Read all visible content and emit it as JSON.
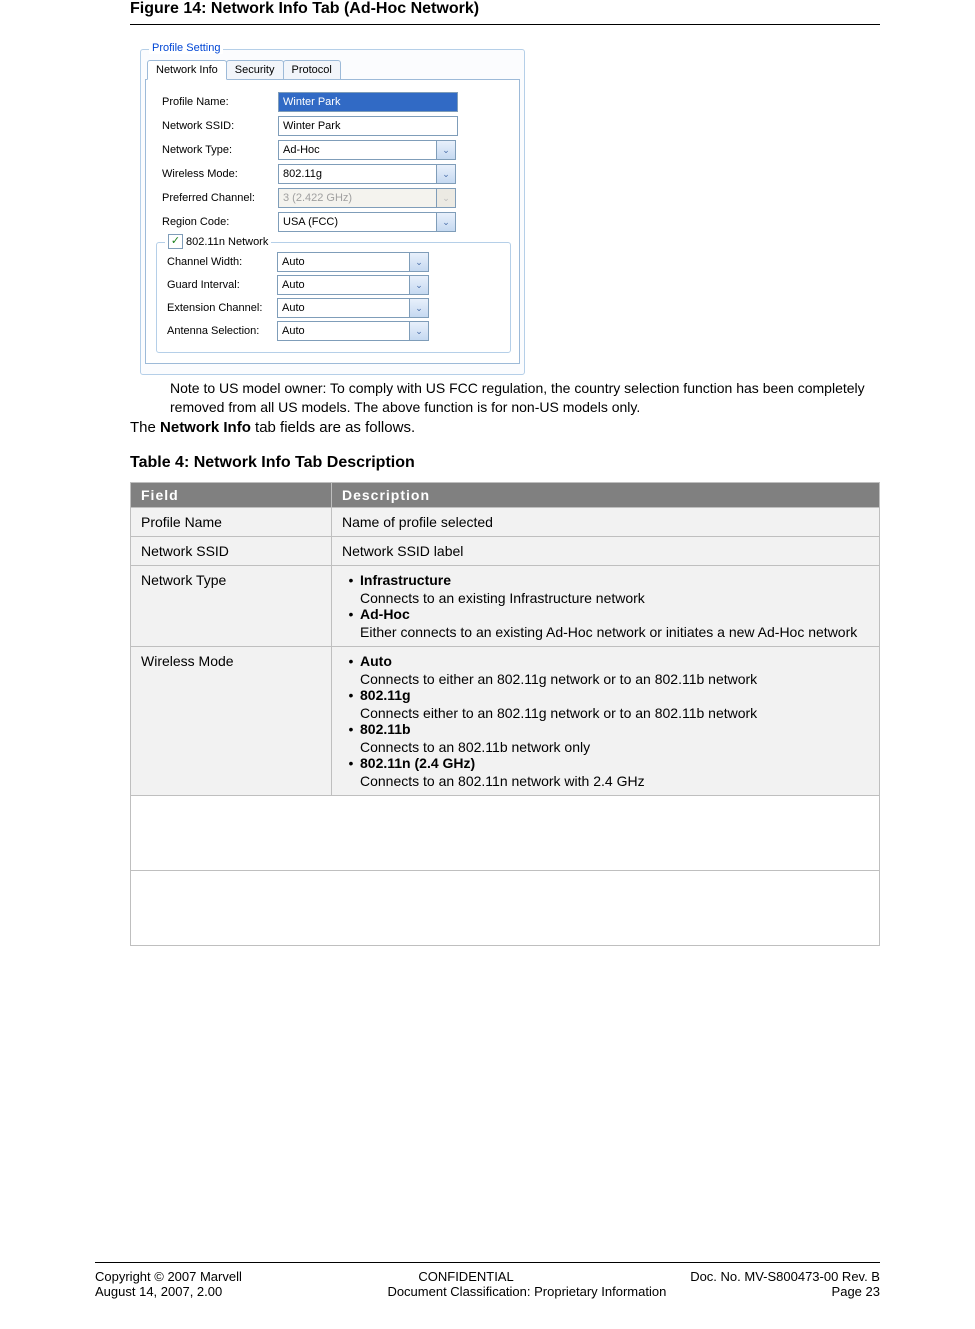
{
  "figure_title": "Figure 14: Network Info Tab (Ad-Hoc Network)",
  "panel": {
    "legend": "Profile Setting",
    "tabs": {
      "network_info": "Network Info",
      "security": "Security",
      "protocol": "Protocol"
    },
    "labels": {
      "profile_name": "Profile Name:",
      "network_ssid": "Network SSID:",
      "network_type": "Network Type:",
      "wireless_mode": "Wireless Mode:",
      "preferred_channel": "Preferred Channel:",
      "region_code": "Region Code:"
    },
    "values": {
      "profile_name": "Winter Park",
      "network_ssid": "Winter Park",
      "network_type": "Ad-Hoc",
      "wireless_mode": "802.11g",
      "preferred_channel": "3 (2.422 GHz)",
      "region_code": "USA (FCC)"
    },
    "sub": {
      "legend": "802.11n Network",
      "labels": {
        "channel_width": "Channel Width:",
        "guard_interval": "Guard Interval:",
        "extension_channel": "Extension Channel:",
        "antenna_selection": "Antenna Selection:"
      },
      "values": {
        "channel_width": "Auto",
        "guard_interval": "Auto",
        "extension_channel": "Auto",
        "antenna_selection": "Auto"
      }
    }
  },
  "note": "Note to US model owner: To comply with US FCC regulation, the country selection function has been completely removed from all US models. The above function is for non-US models only.",
  "lead_pre": "The ",
  "lead_bold": "Network Info",
  "lead_post": " tab fields are as follows.",
  "table_title": "Table 4:     Network Info Tab Description",
  "th_field": "Field",
  "th_desc": "Description",
  "rows": {
    "r1f": "Profile Name",
    "r1d": "Name of profile selected",
    "r2f": "Network SSID",
    "r2d": "Network SSID label",
    "r3f": "Network Type",
    "r3b1": "Infrastructure",
    "r3s1": "Connects to an existing Infrastructure network",
    "r3b2": "Ad-Hoc",
    "r3s2": "Either connects to an existing Ad-Hoc network or initiates a new Ad-Hoc network",
    "r4f": "Wireless Mode",
    "r4b1": "Auto",
    "r4s1": "Connects to either an 802.11g network or to an 802.11b network",
    "r4b2": "802.11g",
    "r4s2": "Connects either to an 802.11g network or to an 802.11b network",
    "r4b3": "802.11b",
    "r4s3": "Connects to an 802.11b network only",
    "r4b4": "802.11n (2.4 GHz)",
    "r4s4": "Connects to an 802.11n network with 2.4 GHz"
  },
  "footer": {
    "l1l": "Copyright © 2007 Marvell",
    "l1c": "CONFIDENTIAL",
    "l1r": "Doc. No. MV-S800473-00 Rev. B",
    "l2l": "August 14, 2007, 2.00",
    "l2c": "Document Classification: Proprietary Information",
    "l2r": "Page 23"
  }
}
